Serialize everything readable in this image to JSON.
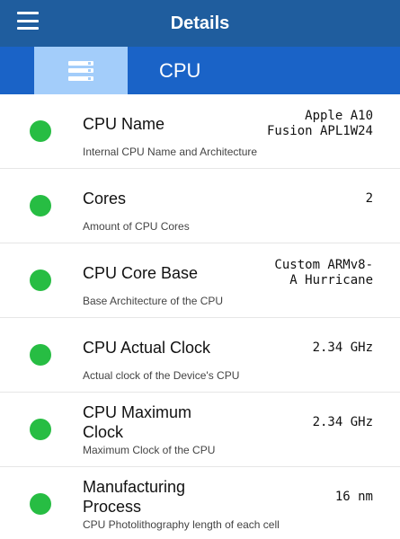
{
  "header": {
    "title": "Details",
    "menu_icon": "hamburger-menu-icon"
  },
  "section": {
    "label": "CPU",
    "icon": "server-icon"
  },
  "status_color": "#27bd43",
  "rows": [
    {
      "title": "CPU Name",
      "description": "Internal CPU Name and Architecture",
      "value": "Apple A10\nFusion APL1W24"
    },
    {
      "title": "Cores",
      "description": "Amount of CPU Cores",
      "value": "2"
    },
    {
      "title": "CPU Core Base",
      "description": "Base Architecture of the CPU",
      "value": "Custom ARMv8-\nA Hurricane"
    },
    {
      "title": "CPU Actual Clock",
      "description": "Actual clock of the Device's CPU",
      "value": "2.34 GHz"
    },
    {
      "title": "CPU Maximum Clock",
      "description": "Maximum Clock of the CPU",
      "value": "2.34 GHz"
    },
    {
      "title": "Manufacturing Process",
      "description": "CPU Photolithography length of each cell",
      "value": "16 nm"
    }
  ]
}
